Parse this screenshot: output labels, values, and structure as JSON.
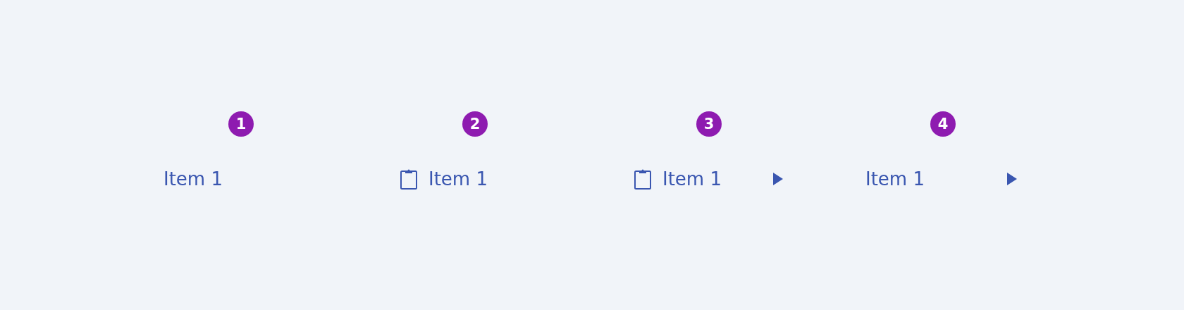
{
  "variants": [
    {
      "badge": "1",
      "item": {
        "label": "Item 1",
        "icon": false,
        "submenu": false
      }
    },
    {
      "badge": "2",
      "item": {
        "label": "Item 1",
        "icon": true,
        "submenu": false
      }
    },
    {
      "badge": "3",
      "item": {
        "label": "Item 1",
        "icon": true,
        "submenu": true
      }
    },
    {
      "badge": "4",
      "item": {
        "label": "Item 1",
        "icon": false,
        "submenu": true
      }
    }
  ]
}
